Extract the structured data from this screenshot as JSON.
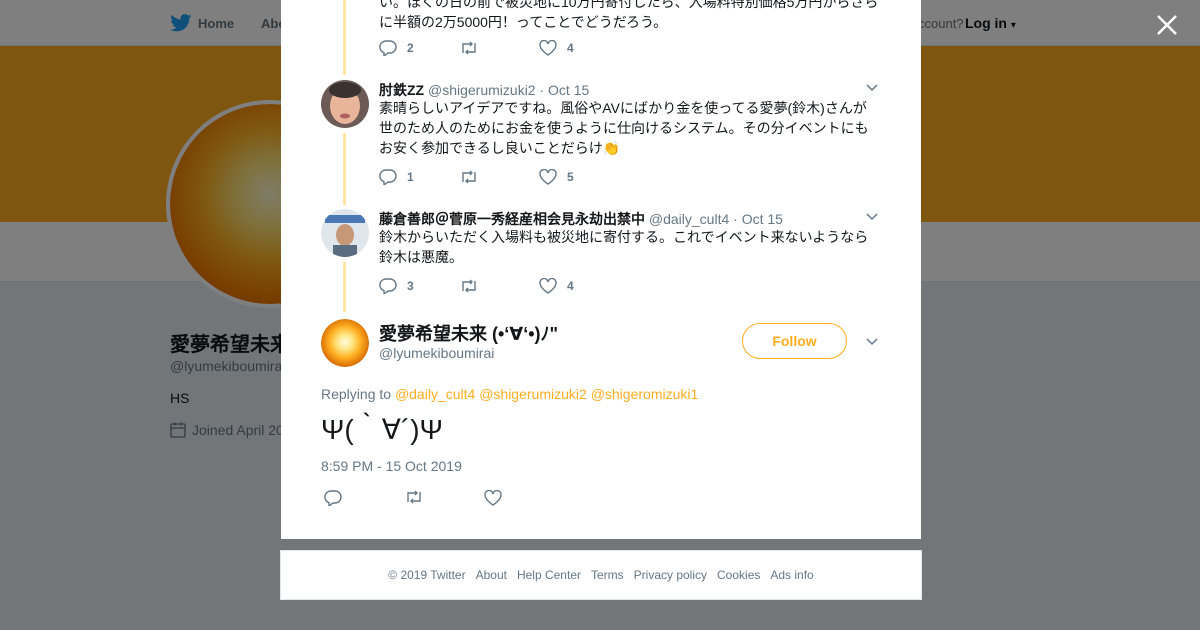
{
  "background": {
    "nav": {
      "home_label": "Home",
      "about_label": "Abo",
      "account_text": "ccount?",
      "login_label": "Log in"
    },
    "profile": {
      "name": "愛夢希望未来",
      "handle": "@lyumekiboumirai",
      "bio": "HS",
      "joined": "Joined April 20"
    },
    "colors": {
      "banner": "#ffad1f",
      "accent": "#ffad1f"
    }
  },
  "modal": {
    "close_icon": "close-icon",
    "top_tweet": {
      "text": "い。ほくの日の前で被災地に10万円寄付したら、入場料特別価格5万円からさらに半額の2万5000円！ってことでどうだろう。",
      "replies": "2",
      "retweets": "",
      "likes": "4"
    },
    "tweets": [
      {
        "name": "肘鉄ZZ",
        "handle": "@shigerumizuki2",
        "dot": "·",
        "date": "Oct 15",
        "text": "素晴らしいアイデアですね。風俗やAVにばかり金を使ってる愛夢(鈴木)さんが世のため人のためにお金を使うように仕向けるシステム。その分イベントにもお安く参加できるし良いことだらけ👏",
        "replies": "1",
        "retweets": "",
        "likes": "5"
      },
      {
        "name": "藤倉善郎＠菅原一秀経産相会見永劫出禁中",
        "handle": "@daily_cult4",
        "dot": "·",
        "date": "Oct 15",
        "text": "鈴木からいただく入場料も被災地に寄付する。これでイベント来ないようなら鈴木は悪魔。",
        "replies": "3",
        "retweets": "",
        "likes": "4"
      }
    ],
    "main_tweet": {
      "name": "愛夢希望未来 (•‘∀‘•)ﾉ\"",
      "handle": "@lyumekiboumirai",
      "follow_label": "Follow",
      "replying_prefix": "Replying to",
      "mentions": [
        "@daily_cult4",
        "@shigerumizuki2",
        "@shigeromizuki1"
      ],
      "text": "Ψ(｀∀´)Ψ",
      "timestamp": "8:59 PM - 15 Oct 2019"
    }
  },
  "footer": {
    "links": [
      "© 2019 Twitter",
      "About",
      "Help Center",
      "Terms",
      "Privacy policy",
      "Cookies",
      "Ads info"
    ]
  }
}
